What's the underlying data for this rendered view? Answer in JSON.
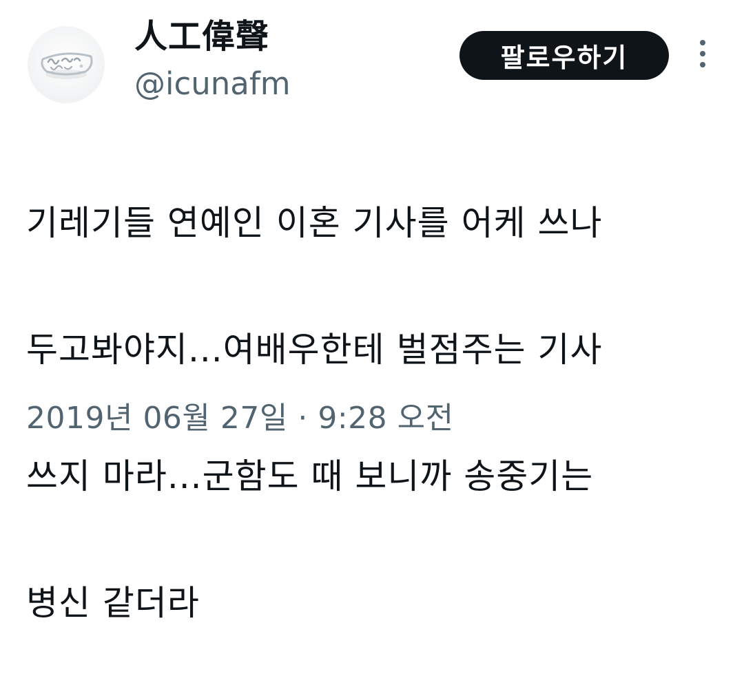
{
  "author": {
    "display_name": "人工偉聲",
    "handle": "@icunafm",
    "avatar_icon": "ring-photo-avatar"
  },
  "actions": {
    "follow_label": "팔로우하기",
    "more_icon": "more-vertical-icon"
  },
  "tweet": {
    "lines": [
      "기레기들 연예인 이혼 기사를 어케 쓰나",
      "두고봐야지...여배우한테 벌점주는 기사",
      "쓰지 마라...군함도 때 보니까 송중기는",
      "병신 같더라"
    ],
    "timestamp": "2019년 06월 27일 · 9:28 오전"
  },
  "colors": {
    "text": "#0f1419",
    "secondary": "#536471",
    "button_bg": "#0f1419",
    "button_text": "#ffffff"
  }
}
